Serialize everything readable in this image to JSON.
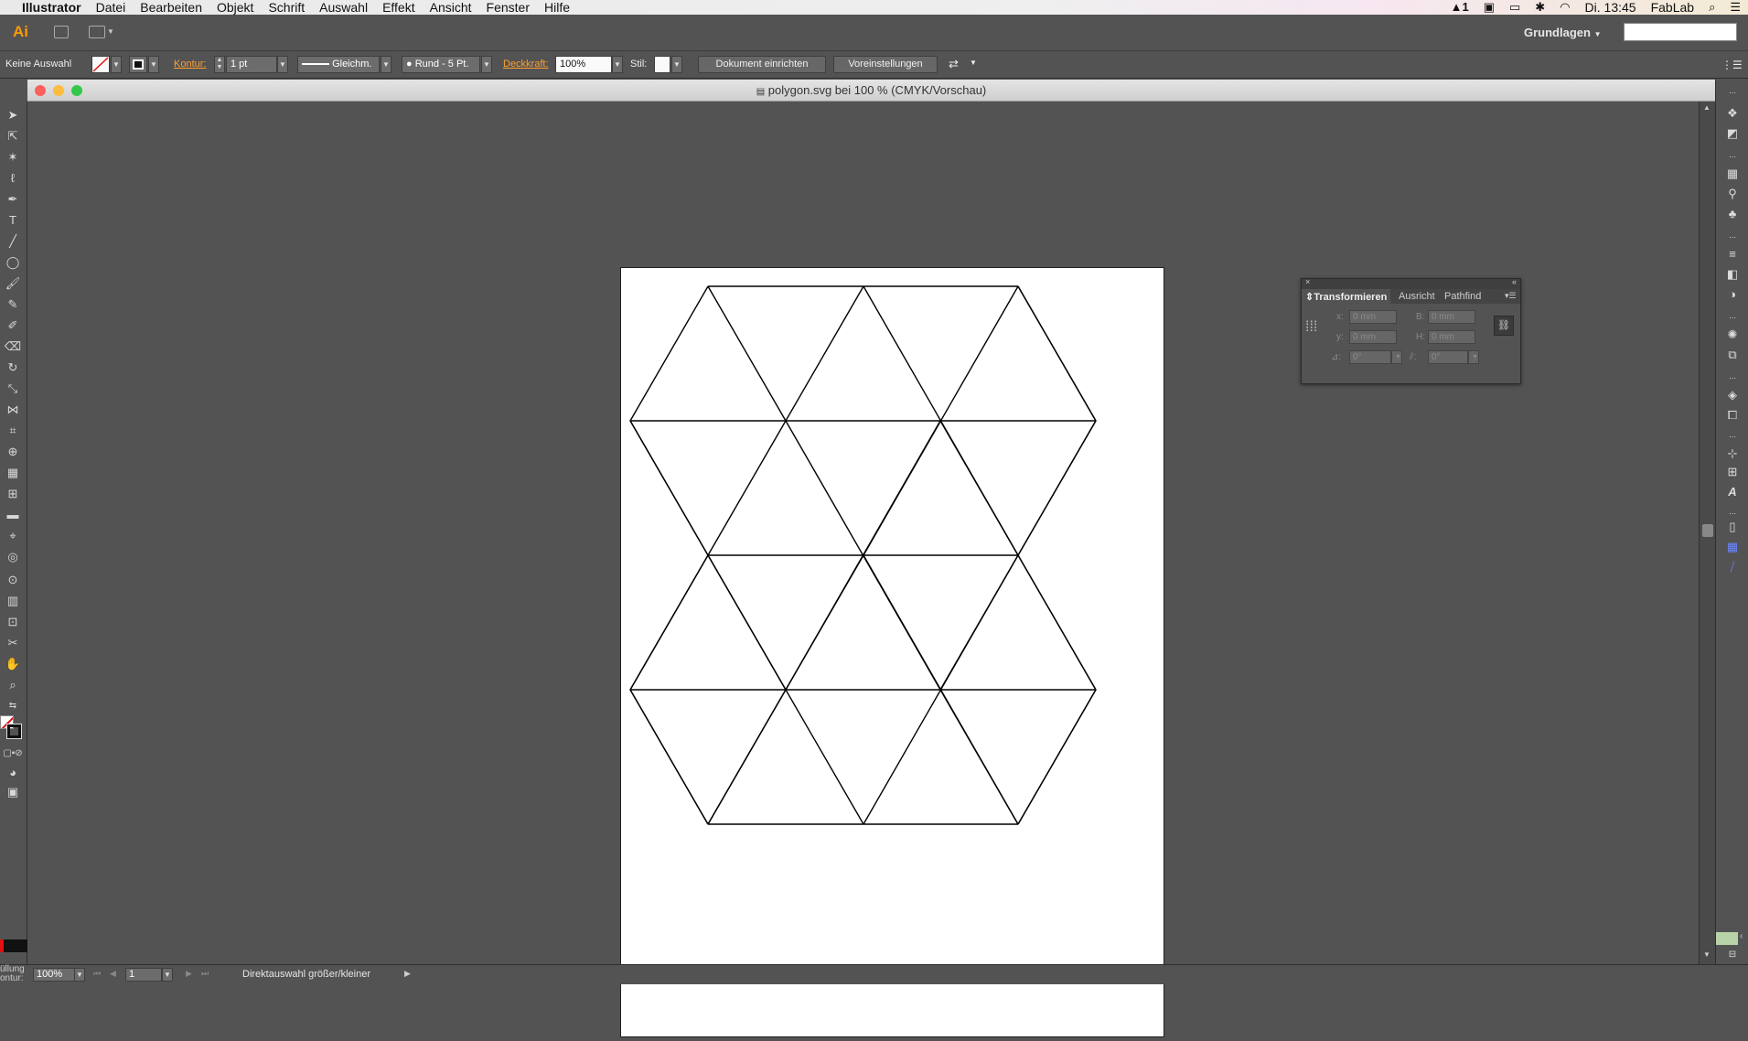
{
  "menubar": {
    "apple": "",
    "items": [
      "Illustrator",
      "Datei",
      "Bearbeiten",
      "Objekt",
      "Schrift",
      "Auswahl",
      "Effekt",
      "Ansicht",
      "Fenster",
      "Hilfe"
    ],
    "status_badge": "1",
    "clock": "Di. 13:45",
    "user": "FabLab"
  },
  "appbar": {
    "logo": "Ai",
    "workspace": "Grundlagen",
    "search_placeholder": ""
  },
  "control": {
    "selection": "Keine Auswahl",
    "stroke_label": "Kontur:",
    "stroke_weight": "1 pt",
    "stroke_profile": "Gleichm.",
    "brush": "Rund - 5 Pt.",
    "opacity_label": "Deckkraft:",
    "opacity": "100%",
    "style_label": "Stil:",
    "doc_setup": "Dokument einrichten",
    "preferences": "Voreinstellungen"
  },
  "document": {
    "title": "polygon.svg bei 100 % (CMYK/Vorschau)"
  },
  "transform_panel": {
    "tabs": [
      "Transformieren",
      "Ausricht",
      "Pathfind"
    ],
    "x_label": "x:",
    "y_label": "y:",
    "w_label": "B:",
    "h_label": "H:",
    "x": "0 mm",
    "y": "0 mm",
    "w": "0 mm",
    "h": "0 mm",
    "angle_label": "⊿:",
    "shear_label": "⫽:",
    "angle": "0°",
    "shear": "0°"
  },
  "statusbar": {
    "zoom": "100%",
    "artboard": "1",
    "status_text": "Direktauswahl größer/kleiner",
    "fill_label": "üllung",
    "stroke_label": "ontur:"
  },
  "colors": {
    "accent_orange": "#ff9a00",
    "ui_bg": "#535353",
    "traffic_red": "#fc605b",
    "traffic_yellow": "#fdbc40",
    "traffic_green": "#34c84a"
  }
}
